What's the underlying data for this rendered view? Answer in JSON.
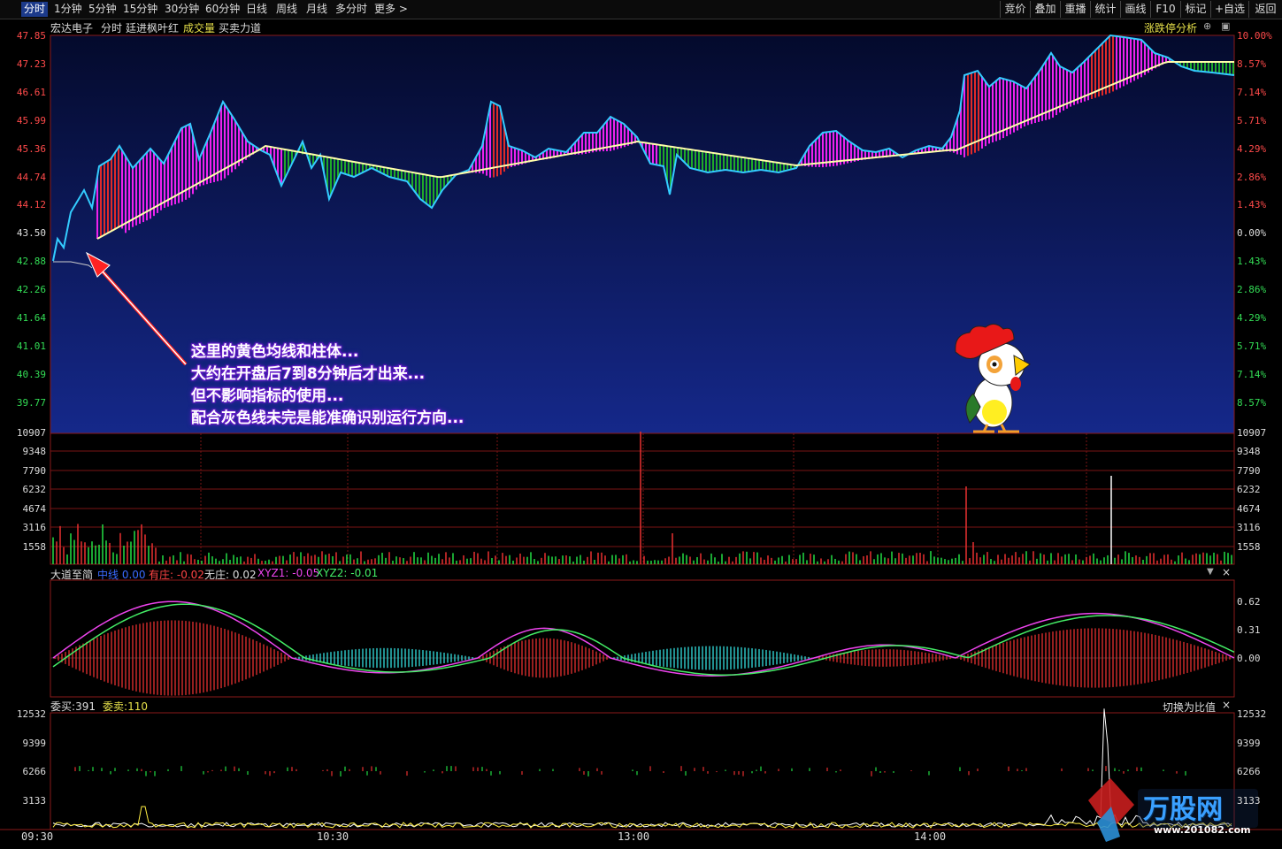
{
  "toolbar": {
    "tabs": [
      "分时",
      "1分钟",
      "5分钟",
      "15分钟",
      "30分钟",
      "60分钟",
      "日线",
      "周线",
      "月线",
      "多分时",
      "更多 >"
    ],
    "right_buttons": [
      "竞价",
      "叠加",
      "重播",
      "统计",
      "画线",
      "标记",
      "+自选",
      "返回"
    ],
    "f10": "F10"
  },
  "price_header": {
    "stock_name": "宏达电子",
    "mode": "分时",
    "indicator": "廷进枫叶红",
    "volume_label": "成交量",
    "force_label": "买卖力道",
    "analysis_link": "涨跌停分析"
  },
  "price_axis": {
    "left": [
      "47.85",
      "47.23",
      "46.61",
      "45.99",
      "45.36",
      "44.74",
      "44.12",
      "43.50",
      "42.88",
      "42.26",
      "41.64",
      "41.01",
      "40.39",
      "39.77"
    ],
    "right": [
      "10.00%",
      "8.57%",
      "7.14%",
      "5.71%",
      "4.29%",
      "2.86%",
      "1.43%",
      "0.00%",
      "1.43%",
      "2.86%",
      "4.29%",
      "5.71%",
      "7.14%",
      "8.57%"
    ]
  },
  "annotation": {
    "lines": [
      "这里的黄色均线和柱体...",
      "大约在开盘后7到8分钟后才出来...",
      "但不影响指标的使用...",
      "配合灰色线未完是能准确识别运行方向..."
    ]
  },
  "volume_axis": [
    "10907",
    "9348",
    "7790",
    "6232",
    "4674",
    "3116",
    "1558"
  ],
  "indicator_panel": {
    "name": "大道至简",
    "zhongxian_label": "中线",
    "zhongxian_value": "0.00",
    "youzhuang_label": "有庄",
    "youzhuang_value": "-0.02",
    "wuzhuang_label": "无庄",
    "wuzhuang_value": "0.02",
    "xyz1_label": "XYZ1",
    "xyz1_value": "-0.05",
    "xyz2_label": "XYZ2",
    "xyz2_value": "-0.01",
    "axis": [
      "0.62",
      "0.31",
      "0.00"
    ]
  },
  "order_panel": {
    "buy_label": "委买",
    "buy_value": "391",
    "sell_label": "委卖",
    "sell_value": "110",
    "switch_label": "切换为比值",
    "axis": [
      "12532",
      "9399",
      "6266",
      "3133"
    ]
  },
  "time_axis": [
    "09:30",
    "10:30",
    "13:00",
    "14:00"
  ],
  "watermark": {
    "brand": "万股网",
    "url": "www.201082.com"
  },
  "colors": {
    "up": "#ff3b3b",
    "down": "#22dd44",
    "magenta": "#ee22ee",
    "price_line": "#33ccff",
    "avg_line": "#ffffaa"
  }
}
